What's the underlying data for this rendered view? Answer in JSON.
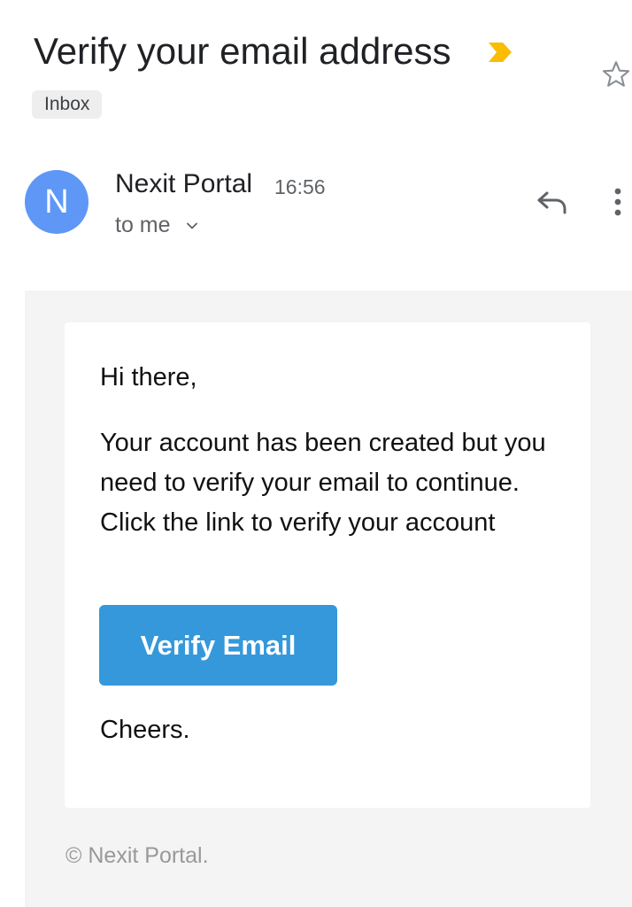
{
  "email": {
    "subject": "Verify your email address",
    "label": "Inbox",
    "important_color": "#fbbc04",
    "sender": {
      "initial": "N",
      "name": "Nexit Portal",
      "time": "16:56",
      "recipients": "to me",
      "avatar_color": "#5e97f6"
    },
    "icons": {
      "importance": "label-important-icon",
      "star": "star-outline-icon",
      "recipients_toggle": "chevron-down-icon",
      "reply": "reply-icon",
      "more": "more-vert-icon"
    }
  },
  "body": {
    "greeting": "Hi there,",
    "message": "Your account has been created but you need to verify your email to continue. Click the link to verify your account",
    "button_label": "Verify Email",
    "button_color": "#3498db",
    "signoff": "Cheers.",
    "footer": "© Nexit Portal."
  }
}
